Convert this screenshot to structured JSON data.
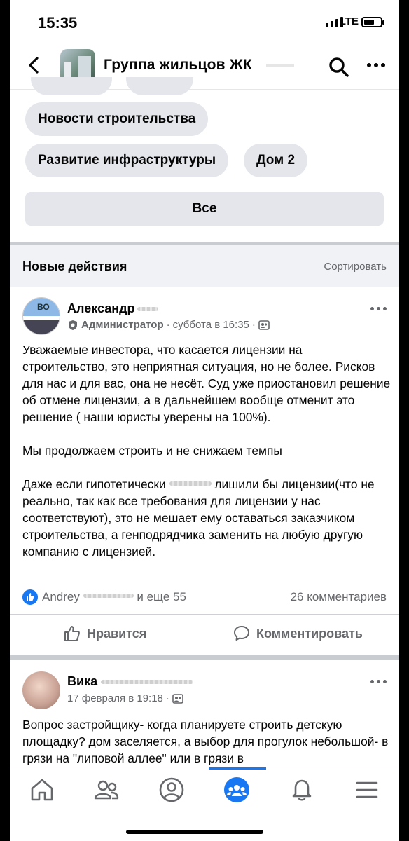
{
  "status_bar": {
    "time": "15:35",
    "network": "LTE"
  },
  "header": {
    "title": "Группа жильцов ЖК",
    "search_icon": "search-icon",
    "more_icon": "more-icon"
  },
  "chips": {
    "row1": [
      "Новости строительства"
    ],
    "row2": [
      "Развитие инфраструктуры",
      "Дом 2"
    ],
    "all_button": "Все"
  },
  "section": {
    "title": "Новые действия",
    "sort": "Сортировать"
  },
  "posts": [
    {
      "author": "Александр",
      "role": "Администратор",
      "time": "суббота в 16:35",
      "text": "Уважаемые инвестора, что касается лицензии на строительство, это неприятная ситуация, но не более. Рисков для нас и для вас, она не несёт. Суд уже приостановил решение об отмене лицензии, а в дальнейшем вообще отменит это решение ( наши юристы уверены на 100%).\n\nМы продолжаем строить и не снижаем темпы\n\nДаже если гипотетически ",
      "text_tail": " лишили бы лицензии(что не реально, так как все требования для лицензии у нас соответствуют), это не мешает ему оставаться заказчиком строительства, а генподрядчика заменить на любую другую компанию с лицензией.",
      "reactions_text": "Andrey",
      "reactions_suffix": "и еще 55",
      "comments": "26 комментариев",
      "like_label": "Нравится",
      "comment_label": "Комментировать"
    },
    {
      "author": "Вика",
      "time": "17 февраля в 19:18",
      "text": "Вопрос застройщику- когда планируете строить детскую площадку? дом заселяется, а выбор для прогулок небольшой-  в грязи на \"липовой аллее\"  или в грязи в"
    }
  ],
  "tabbar": {
    "items": [
      {
        "icon": "home-icon"
      },
      {
        "icon": "friends-icon"
      },
      {
        "icon": "profile-icon"
      },
      {
        "icon": "groups-icon",
        "active": true
      },
      {
        "icon": "bell-icon"
      },
      {
        "icon": "menu-icon"
      }
    ],
    "accent": "#1877f2"
  }
}
